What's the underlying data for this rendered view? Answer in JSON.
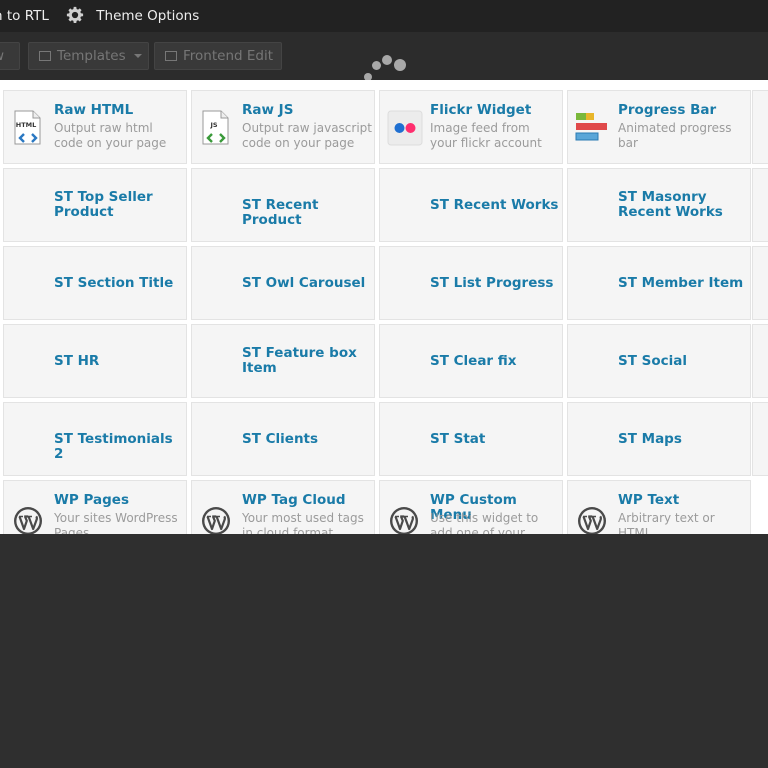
{
  "adminbar": {
    "rtl_label": "h to RTL",
    "theme_options_label": "Theme Options"
  },
  "toolbar": {
    "first_label": "w",
    "templates_label": "Templates",
    "frontend_label": "Frontend Edit"
  },
  "elements": [
    {
      "title": "Raw HTML",
      "desc": "Output raw html code on your page",
      "icon": "html-file-icon"
    },
    {
      "title": "Raw JS",
      "desc": "Output raw javascript code on your page",
      "icon": "js-file-icon"
    },
    {
      "title": "Flickr Widget",
      "desc": "Image feed from your flickr account",
      "icon": "flickr-icon"
    },
    {
      "title": "Progress Bar",
      "desc": "Animated progress bar",
      "icon": "progress-bar-icon"
    },
    {
      "title": "ST Top Seller Product",
      "desc": "",
      "icon": ""
    },
    {
      "title": "ST Recent Product",
      "desc": "",
      "icon": ""
    },
    {
      "title": "ST Recent Works",
      "desc": "",
      "icon": ""
    },
    {
      "title": "ST Masonry Recent Works",
      "desc": "",
      "icon": ""
    },
    {
      "title": "ST Section Title",
      "desc": "",
      "icon": ""
    },
    {
      "title": "ST Owl Carousel",
      "desc": "",
      "icon": ""
    },
    {
      "title": "ST List Progress",
      "desc": "",
      "icon": ""
    },
    {
      "title": "ST Member Item",
      "desc": "",
      "icon": ""
    },
    {
      "title": "ST HR",
      "desc": "",
      "icon": ""
    },
    {
      "title": "ST Feature box Item",
      "desc": "",
      "icon": ""
    },
    {
      "title": "ST Clear fix",
      "desc": "",
      "icon": ""
    },
    {
      "title": "ST Social",
      "desc": "",
      "icon": ""
    },
    {
      "title": "ST Testimonials 2",
      "desc": "",
      "icon": ""
    },
    {
      "title": "ST Clients",
      "desc": "",
      "icon": ""
    },
    {
      "title": "ST Stat",
      "desc": "",
      "icon": ""
    },
    {
      "title": "ST Maps",
      "desc": "",
      "icon": ""
    },
    {
      "title": "WP Pages",
      "desc": "Your sites WordPress Pages",
      "icon": "wordpress-icon"
    },
    {
      "title": "WP Tag Cloud",
      "desc": "Your most used tags in cloud format",
      "icon": "wordpress-icon"
    },
    {
      "title": "WP Custom Menu",
      "desc": "Use this widget to add one of your custom menus",
      "icon": "wordpress-icon"
    },
    {
      "title": "WP Text",
      "desc": "Arbitrary text or HTML",
      "icon": "wordpress-icon"
    }
  ],
  "colors": {
    "title": "#1a7ba8",
    "desc": "#9b9b9b",
    "tile_bg": "#f5f5f5",
    "overlay": "#2f2f2f"
  }
}
